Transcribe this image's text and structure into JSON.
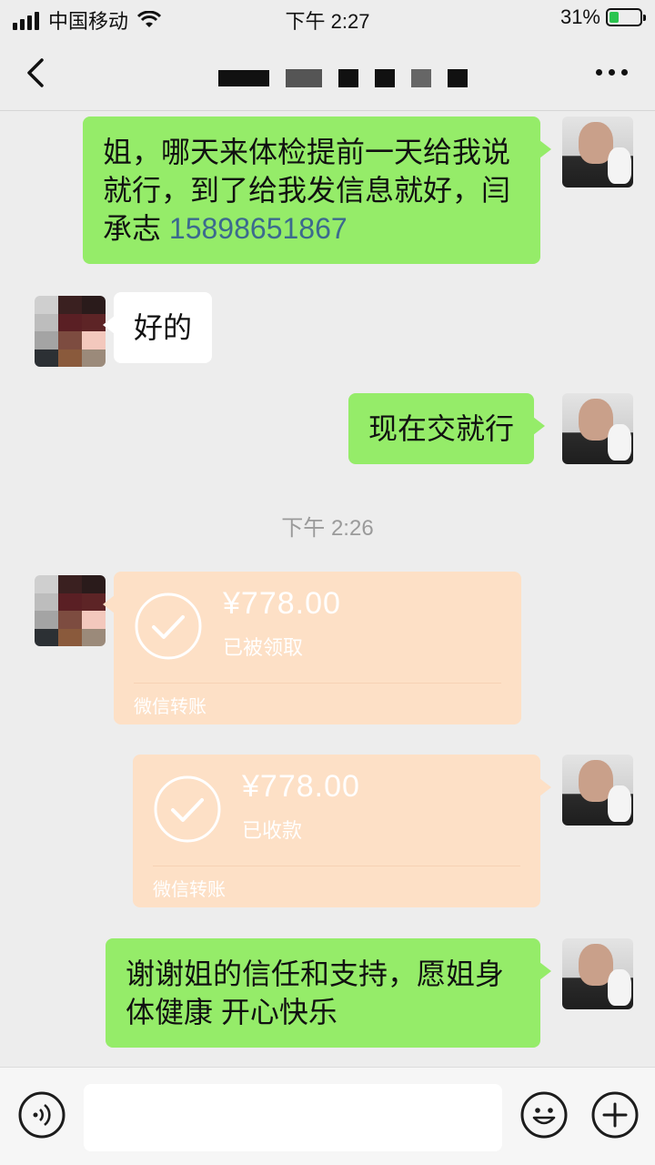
{
  "status_bar": {
    "carrier": "中国移动",
    "time": "下午 2:27",
    "battery_percent": "31%",
    "battery_level": 0.31,
    "battery_color": "#2bc44f"
  },
  "nav": {
    "back_icon": "chevron-left-icon",
    "more_icon": "ellipsis-icon"
  },
  "messages": [
    {
      "side": "right",
      "type": "text",
      "text": "姐，哪天来体检提前一天给我说就行，到了给我发信息就好，闫承志 ",
      "phone": "15898651867"
    },
    {
      "side": "left",
      "type": "text",
      "text": "好的"
    },
    {
      "side": "right",
      "type": "text",
      "text": "现在交就行"
    },
    {
      "type": "time",
      "text": "下午 2:26"
    },
    {
      "side": "left",
      "type": "transfer",
      "amount": "¥778.00",
      "status": "已被领取",
      "footer": "微信转账"
    },
    {
      "side": "right",
      "type": "transfer",
      "amount": "¥778.00",
      "status": "已收款",
      "footer": "微信转账"
    },
    {
      "side": "right",
      "type": "text",
      "text": "谢谢姐的信任和支持，愿姐身体健康 开心快乐"
    }
  ],
  "input_bar": {
    "placeholder": "",
    "voice_icon": "voice-icon",
    "emoji_icon": "emoji-icon",
    "plus_icon": "plus-icon"
  },
  "colors": {
    "green_bubble": "#95ec69",
    "transfer_bubble": "#fde0c6",
    "background": "#ededed",
    "link": "#3c6a8e"
  }
}
